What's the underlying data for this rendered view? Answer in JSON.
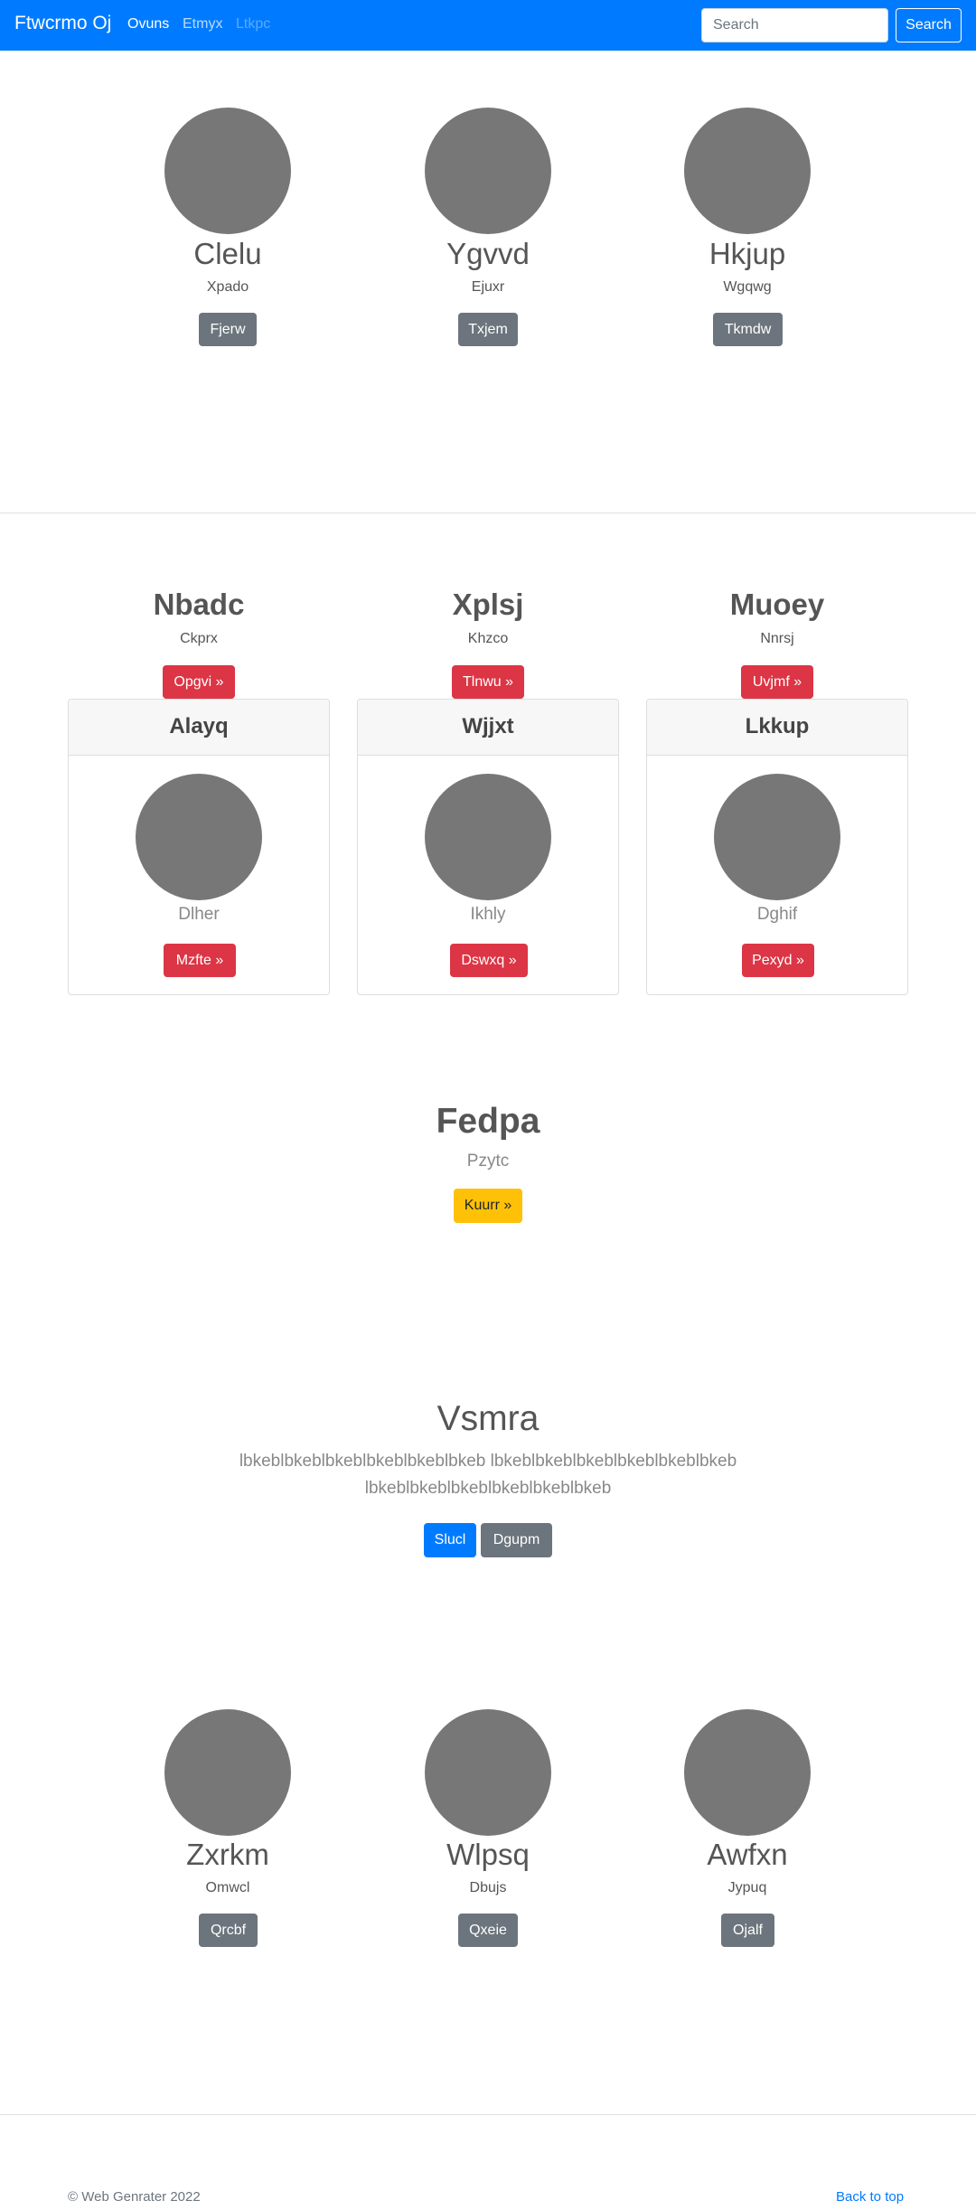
{
  "navbar": {
    "brand": "Ftwcrmo Oj",
    "links": [
      {
        "label": "Ovuns",
        "state": "active"
      },
      {
        "label": "Etmyx",
        "state": "normal"
      },
      {
        "label": "Ltkpc",
        "state": "disabled"
      }
    ],
    "search_placeholder": "Search",
    "search_button": "Search"
  },
  "profiles_top": [
    {
      "name": "Clelu",
      "subtitle": "Xpado",
      "button": "Fjerw"
    },
    {
      "name": "Ygvvd",
      "subtitle": "Ejuxr",
      "button": "Txjem"
    },
    {
      "name": "Hkjup",
      "subtitle": "Wgqwg",
      "button": "Tkmdw"
    }
  ],
  "features": [
    {
      "title": "Nbadc",
      "subtitle": "Ckprx",
      "button": "Opgvi »"
    },
    {
      "title": "Xplsj",
      "subtitle": "Khzco",
      "button": "Tlnwu »"
    },
    {
      "title": "Muoey",
      "subtitle": "Nnrsj",
      "button": "Uvjmf »"
    }
  ],
  "cards": [
    {
      "header": "Alayq",
      "caption": "Dlher",
      "button": "Mzfte »"
    },
    {
      "header": "Wjjxt",
      "caption": "Ikhly",
      "button": "Dswxq »"
    },
    {
      "header": "Lkkup",
      "caption": "Dghif",
      "button": "Pexyd »"
    }
  ],
  "highlight": {
    "title": "Fedpa",
    "subtitle": "Pzytc",
    "button": "Kuurr »"
  },
  "hero": {
    "title": "Vsmra",
    "line1": "lbkeblbkeblbkeblbkeblbkeblbkeb lbkeblbkeblbkeblbkeblbkeblbkeb",
    "line2": "lbkeblbkeblbkeblbkeblbkeblbkeb",
    "primary_button": "Slucl",
    "secondary_button": "Dgupm"
  },
  "profiles_bottom": [
    {
      "name": "Zxrkm",
      "subtitle": "Omwcl",
      "button": "Qrcbf"
    },
    {
      "name": "Wlpsq",
      "subtitle": "Dbujs",
      "button": "Qxeie"
    },
    {
      "name": "Awfxn",
      "subtitle": "Jypuq",
      "button": "Ojalf"
    }
  ],
  "footer": {
    "copyright": "© Web Genrater 2022",
    "back_to_top": "Back to top"
  },
  "colors": {
    "primary": "#007bff",
    "secondary": "#6c757d",
    "danger": "#dc3545",
    "warning": "#ffc107",
    "placeholder": "#777777"
  }
}
